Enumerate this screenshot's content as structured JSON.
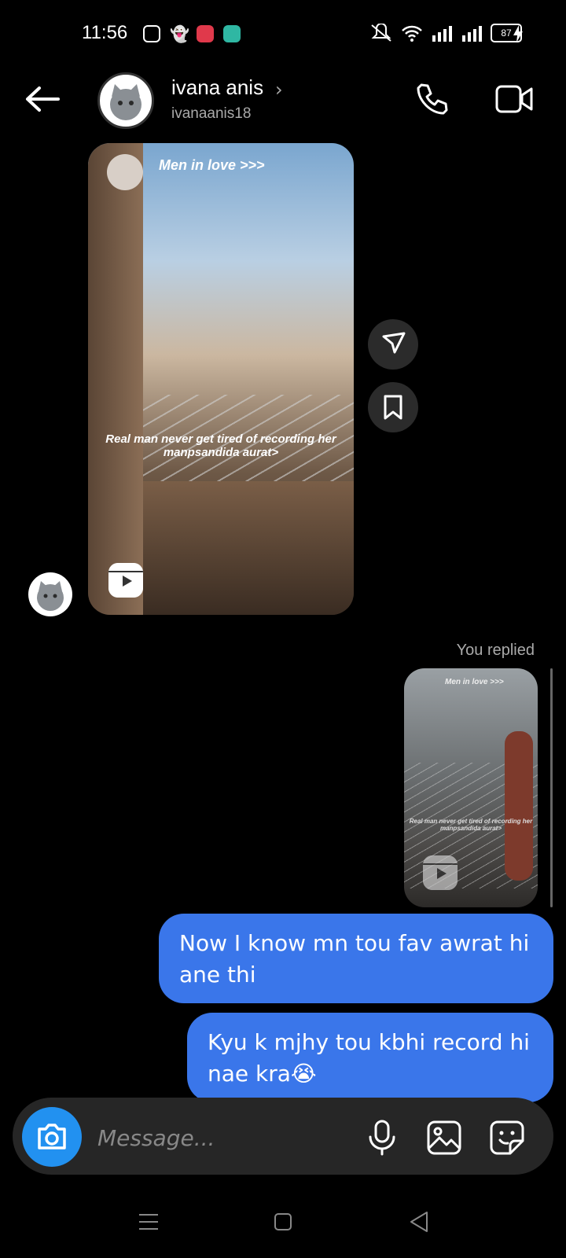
{
  "status_bar": {
    "time": "11:56",
    "battery": "87",
    "icons": [
      "instagram-icon",
      "snapchat-icon",
      "screen-record-icon",
      "app-icon",
      "mute-icon",
      "wifi-icon",
      "signal-icon",
      "signal-icon",
      "charging-icon"
    ]
  },
  "header": {
    "name": "ivana anis",
    "username": "ivanaanis18",
    "chevron": "›"
  },
  "reel_shared": {
    "title": "Men in love >>>",
    "caption": "Real man never get tired of recording her manpsandida aurat>"
  },
  "reply_label": "You replied",
  "reel_reply": {
    "title": "Men in love >>>",
    "caption": "Real man never get tired of recording her manpsandida aurat>"
  },
  "messages": [
    {
      "text": "Now I know mn tou fav awrat hi ane thi"
    },
    {
      "text": "Kyu k mjhy tou kbhi record hi nae kra😭"
    }
  ],
  "composer": {
    "placeholder": "Message..."
  },
  "colors": {
    "bubble": "#3a76ea",
    "camera_button": "#2291f0",
    "composer": "#262626"
  }
}
